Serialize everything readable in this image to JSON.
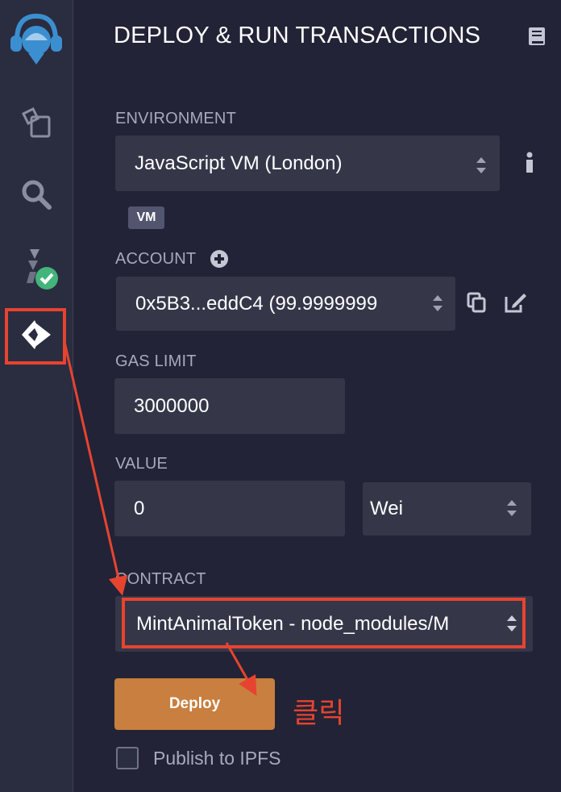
{
  "panel": {
    "title": "DEPLOY & RUN TRANSACTIONS"
  },
  "sidebar": {
    "items": [
      {
        "name": "home-logo"
      },
      {
        "name": "file-explorer"
      },
      {
        "name": "search"
      },
      {
        "name": "solidity-compiler"
      },
      {
        "name": "deploy-run",
        "active": true
      }
    ]
  },
  "environment": {
    "label": "ENVIRONMENT",
    "value": "JavaScript VM (London)",
    "badge": "VM"
  },
  "account": {
    "label": "ACCOUNT",
    "value": "0x5B3...eddC4 (99.9999999"
  },
  "gas_limit": {
    "label": "GAS LIMIT",
    "value": "3000000"
  },
  "value": {
    "label": "VALUE",
    "amount": "0",
    "unit": "Wei"
  },
  "contract": {
    "label": "CONTRACT",
    "value": "MintAnimalToken - node_modules/M"
  },
  "deploy": {
    "label": "Deploy"
  },
  "publish": {
    "label": "Publish to IPFS"
  },
  "annotation": {
    "text": "클릭",
    "color": "#e64430"
  },
  "colors": {
    "accent": "#c97f3f",
    "background": "#222336",
    "sidebar": "#2a2c3f",
    "input": "#353749"
  }
}
